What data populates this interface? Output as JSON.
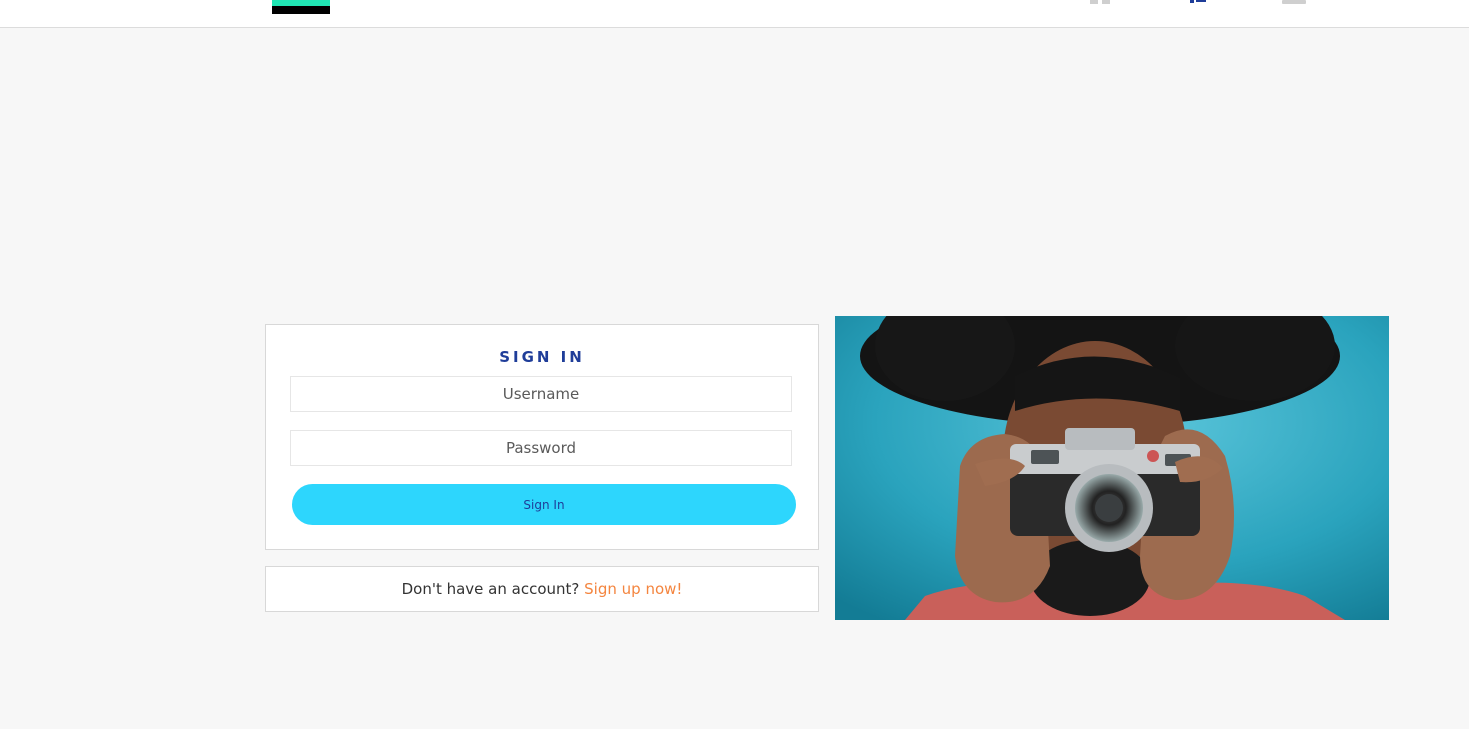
{
  "navbar": {
    "icons": [
      "grid-icon",
      "user-icon",
      "box-icon"
    ],
    "logo_colors": {
      "top": "#20e6b4",
      "bottom": "#000000"
    }
  },
  "signin": {
    "title": "SIGN IN",
    "username_placeholder": "Username",
    "password_placeholder": "Password",
    "button_label": "Sign In"
  },
  "signup": {
    "prompt": "Don't have an account?",
    "link_label": "Sign up now!"
  },
  "colors": {
    "page_background": "#f7f7f7",
    "title": "#1f3d99",
    "button": "#2dd6fd",
    "link": "#f4853f",
    "photo_background": "#2aa3bd"
  }
}
